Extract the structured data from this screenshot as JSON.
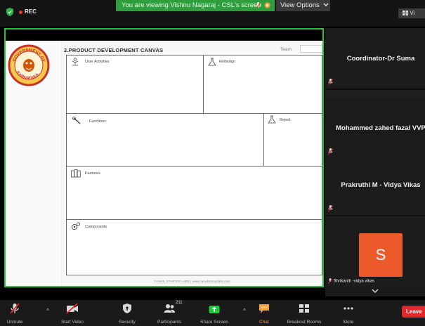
{
  "top_bar": {
    "rec_label": "REC",
    "banner_text": "You are viewing Vishnu Nagaraj - CSL's screen",
    "view_options_label": "View Options",
    "view_mode_label": "Vi"
  },
  "shared_screen": {
    "canvas_title": "2.PRODUCT DEVELOPMENT CANVAS",
    "team_label": "Team",
    "cells": {
      "user_activities": "User Activities",
      "redesign": "Redesign",
      "functions": "Functions",
      "reject": "Reject",
      "features": "Features",
      "components": "Components"
    },
    "footer": "CANVIL STARTUP LABS | www.canvilstartuplabs.com",
    "emblem_text": [
      "GOVERNMENT OF",
      "KARNATAKA"
    ]
  },
  "participants": {
    "tiles": [
      {
        "name": "Coordinator-Dr Suma",
        "muted": true
      },
      {
        "name": "Mohammed zahed fazal VVP",
        "muted": true
      },
      {
        "name": "Prakruthi M - Vidya Vikas",
        "muted": true
      },
      {
        "name": "Shrikanth -vidya vikas",
        "avatar_letter": "S",
        "avatar_color": "#ec5a2b",
        "muted": true
      }
    ]
  },
  "toolbar": {
    "unmute": "Unmute",
    "start_video": "Start Video",
    "security": "Security",
    "participants": "Participants",
    "participants_count": "211",
    "share_screen": "Share Screen",
    "chat": "Chat",
    "breakout_rooms": "Breakout Rooms",
    "more": "More",
    "leave": "Leave"
  },
  "colors": {
    "share_border": "#28c23c",
    "banner_green": "#2f9e3d",
    "share_screen_green": "#23c73a",
    "chat_orange": "#f6a23a",
    "leave_red": "#e02828",
    "mute_red": "#e02828"
  }
}
